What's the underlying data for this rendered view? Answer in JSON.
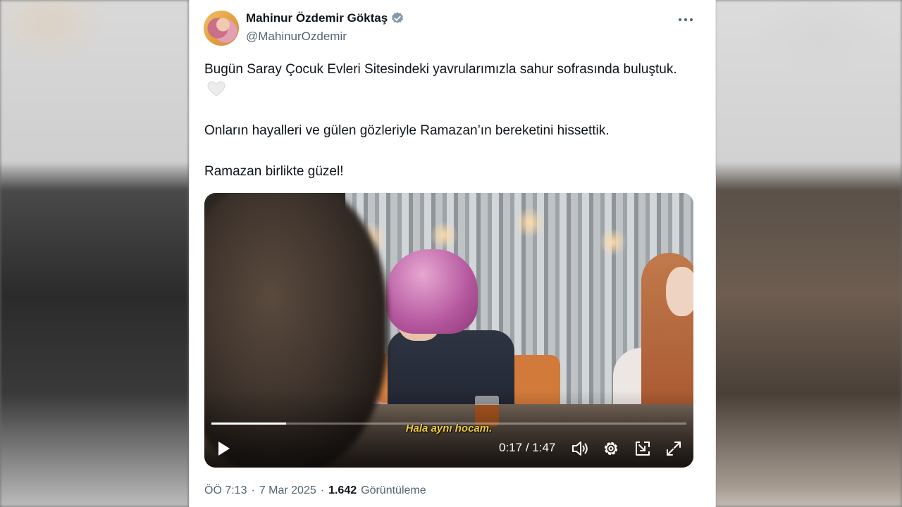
{
  "tweet": {
    "author_name": "Mahinur Özdemir Göktaş",
    "author_handle": "@MahinurOzdemir",
    "text_paragraph_1": "Bugün Saray Çocuk Evleri Sitesindeki yavrularımızla sahur sofrasında buluştuk.",
    "text_paragraph_2": "Onların hayalleri ve gülen gözleriyle Ramazan’ın bereketini hissettik.",
    "text_paragraph_3": "Ramazan birlikte güzel!",
    "time": "ÖÖ 7:13",
    "separator": "·",
    "date": "7 Mar 2025",
    "views_count": "1.642",
    "views_label": "Görüntüleme"
  },
  "video": {
    "subtitle": "Hala aynı hocam.",
    "current_time": "0:17",
    "time_separator": "/",
    "duration": "1:47",
    "progress": 0.158
  },
  "icons": {
    "verified": "verified-badge-icon",
    "more": "more-options-icon",
    "heart": "white-heart-emoji",
    "play": "play-icon",
    "volume": "volume-icon",
    "settings": "settings-gear-icon",
    "pip": "picture-in-picture-icon",
    "fullscreen": "fullscreen-icon"
  },
  "colors": {
    "verified": "#829aab",
    "text": "#0f1419",
    "secondary": "#536471",
    "subtitle": "#f1cf3b"
  }
}
